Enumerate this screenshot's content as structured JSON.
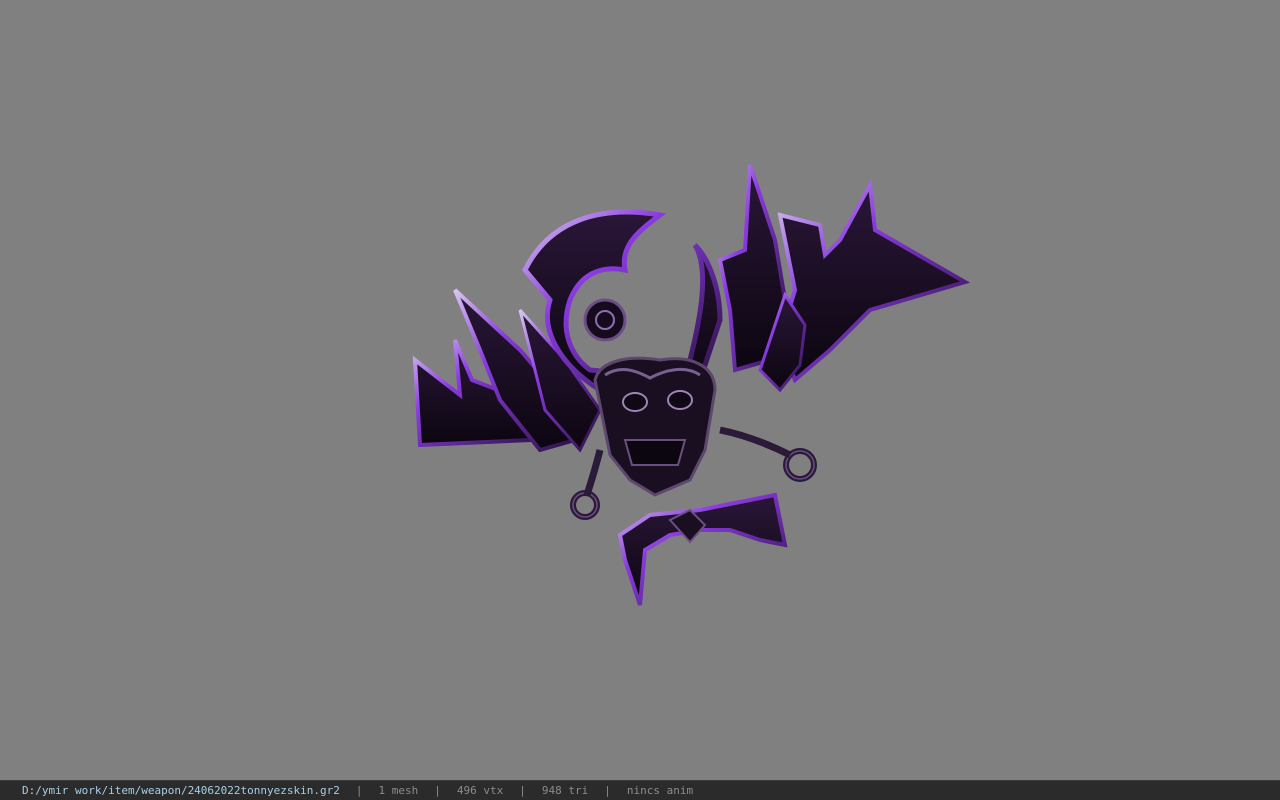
{
  "viewer": {
    "background_color": "#808080",
    "model_colors": {
      "body": "#120a18",
      "mid": "#2a1638",
      "edge": "#7a2fd0",
      "highlight": "#c9b4e8"
    }
  },
  "status_bar": {
    "file_path": "D:/ymir work/item/weapon/24062022tonnyezskin.gr2",
    "separator": "|",
    "mesh_count": "1 mesh",
    "vertex_count": "496 vtx",
    "triangle_count": "948 tri",
    "animation": "nincs anim"
  }
}
